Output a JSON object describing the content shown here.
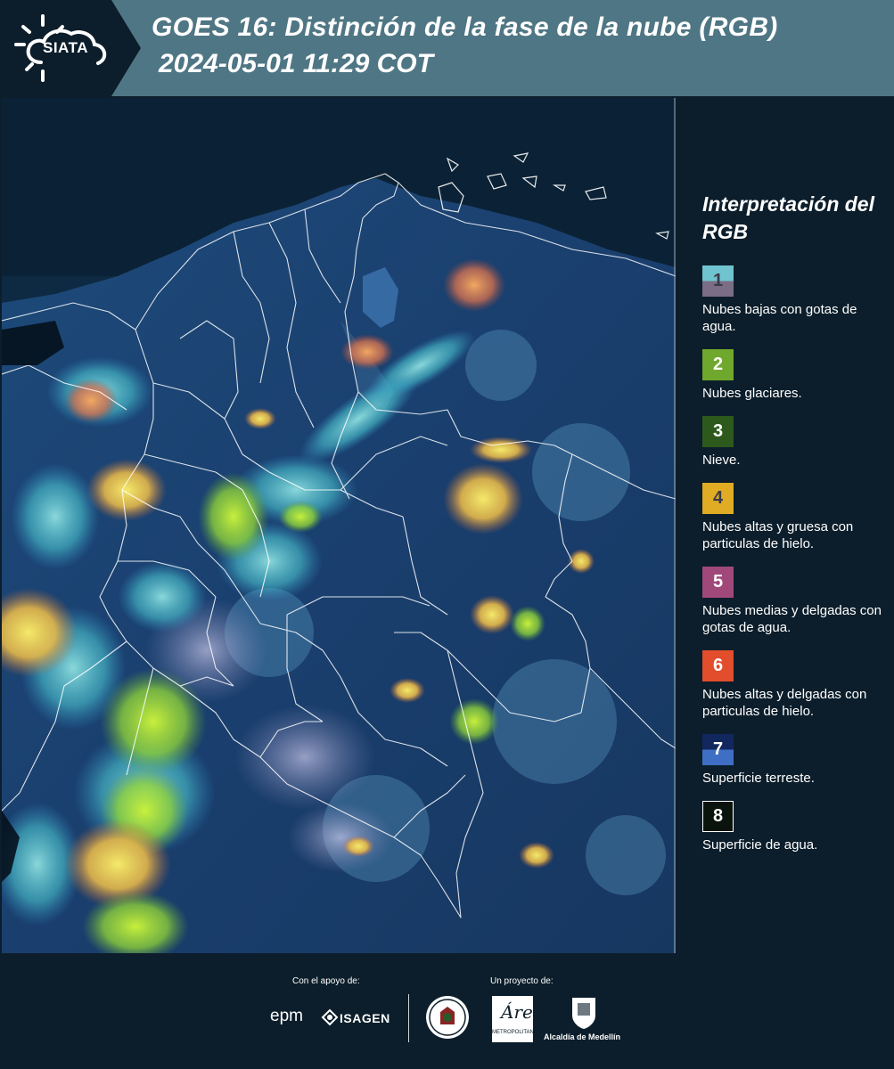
{
  "header": {
    "title_line1": "GOES 16: Distinción de la fase de la nube (RGB)",
    "title_line2": "2024-05-01 11:29 COT",
    "logo_text": "SIATA",
    "background_color": "#4f7684",
    "logo_band_color": "#0c1e2b"
  },
  "legend": {
    "title": "Interpretación del RGB",
    "items": [
      {
        "number": "1",
        "top_color": "#6fc4cf",
        "bottom_color": "#7b6d86",
        "label": "Nubes bajas con gotas de agua."
      },
      {
        "number": "2",
        "top_color": "#6fa82c",
        "bottom_color": "#6fa82c",
        "label": "Nubes glaciares."
      },
      {
        "number": "3",
        "top_color": "#2d5a1c",
        "bottom_color": "#2d5a1c",
        "label": "Nieve."
      },
      {
        "number": "4",
        "top_color": "#e0ac24",
        "bottom_color": "#e0ac24",
        "label": "Nubes altas y gruesa con particulas de hielo."
      },
      {
        "number": "5",
        "top_color": "#a1487a",
        "bottom_color": "#a1487a",
        "label": "Nubes medias y delgadas con gotas de agua."
      },
      {
        "number": "6",
        "top_color": "#e24d2b",
        "bottom_color": "#e24d2b",
        "label": "Nubes altas y delgadas con particulas de hielo."
      },
      {
        "number": "7",
        "top_color": "#11275e",
        "bottom_color": "#3f6fc4",
        "label": "Superficie terreste."
      },
      {
        "number": "8",
        "top_color": "#0b140c",
        "bottom_color": "#0b140c",
        "label": "Superficie de agua."
      }
    ]
  },
  "footer": {
    "support_label": "Con el apoyo de:",
    "project_label": "Un proyecto de:",
    "epm": "epm",
    "isagen": "ISAGEN",
    "area": "Área",
    "metro": "METROPOLITANA",
    "alcaldia": "Alcaldía de Medellín"
  },
  "map": {
    "type": "satellite-rgb-composite",
    "region": "Colombia",
    "background_color": "#0c2740"
  }
}
